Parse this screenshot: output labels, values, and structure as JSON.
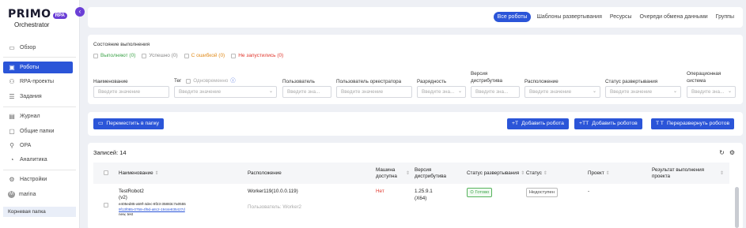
{
  "app": {
    "logo_main": "PRIMO",
    "logo_badge": "RPA",
    "logo_sub": "Orchestrator",
    "collapse_icon": "‹"
  },
  "sidebar": {
    "items": [
      {
        "label": "Обзор",
        "icon": "▭"
      },
      {
        "label": "Роботы",
        "icon": "▣"
      },
      {
        "label": "RPA-проекты",
        "icon": "⚇"
      },
      {
        "label": "Задания",
        "icon": "☰"
      },
      {
        "label": "Журнал",
        "icon": "▤"
      },
      {
        "label": "Общие папки",
        "icon": "▢"
      },
      {
        "label": "OPA",
        "icon": "⚲"
      },
      {
        "label": "Аналитика",
        "icon": "◔"
      },
      {
        "label": "Настройки",
        "icon": "⚙"
      }
    ],
    "user": {
      "name": "marina",
      "initial": "M"
    },
    "folder": "Корневая папка"
  },
  "top_tabs": [
    "Все роботы",
    "Шаблоны развертывания",
    "Ресурсы",
    "Очереди обмена данными",
    "Группы"
  ],
  "filters": {
    "status_title": "Состояние выполнения",
    "statuses": [
      {
        "label": "Выполняют (0)",
        "color": "#3ea44a"
      },
      {
        "label": "Успешно (0)",
        "color": "#888888"
      },
      {
        "label": "С ошибкой (0)",
        "color": "#e08a1a"
      },
      {
        "label": "Не запустились (0)",
        "color": "#e0362c"
      }
    ],
    "labels": {
      "name": "Наименование",
      "tag": "Тег",
      "tag_single": "Одновременно",
      "user": "Пользователь",
      "orch_user": "Пользователь оркестратора",
      "bitness": "Разрядность",
      "dist_version": "Версия дистрибутива",
      "location": "Расположение",
      "deploy_status": "Статус развертывания",
      "os": "Операционная система"
    },
    "placeholder": "Введите значение",
    "placeholder_short": "Введите зна..."
  },
  "actions": {
    "move": "Переместить в папку",
    "add_robot": "Добавить робота",
    "add_robots": "Добавить роботов",
    "redeploy": "Переразвернуть роботов"
  },
  "table": {
    "records": "Записей: 14",
    "headers": {
      "name": "Наименование",
      "location": "Расположение",
      "machine": "Машина доступна",
      "version": "Версия дистрибутива",
      "deploy_status": "Статус развертывания",
      "status": "Статус",
      "project": "Проект",
      "result": "Результат выполнения проекта"
    },
    "rows": [
      {
        "name": "TestRobot2",
        "name_suffix": "(v2)",
        "id": "e405ed85-a59f-4dec-8f23-35883c7a0555",
        "link": "9f13f085-0758-4f9d-a8c2-1944e835427d",
        "tag": "new, test",
        "location": "Worker119(10.0.0.119)",
        "users": "Пользователь: Worker2",
        "machine": "Нет",
        "version": "1.25.9.1",
        "arch": "(X64)",
        "deploy_status": "Готово",
        "status": "Недоступен",
        "project": "-"
      }
    ]
  }
}
